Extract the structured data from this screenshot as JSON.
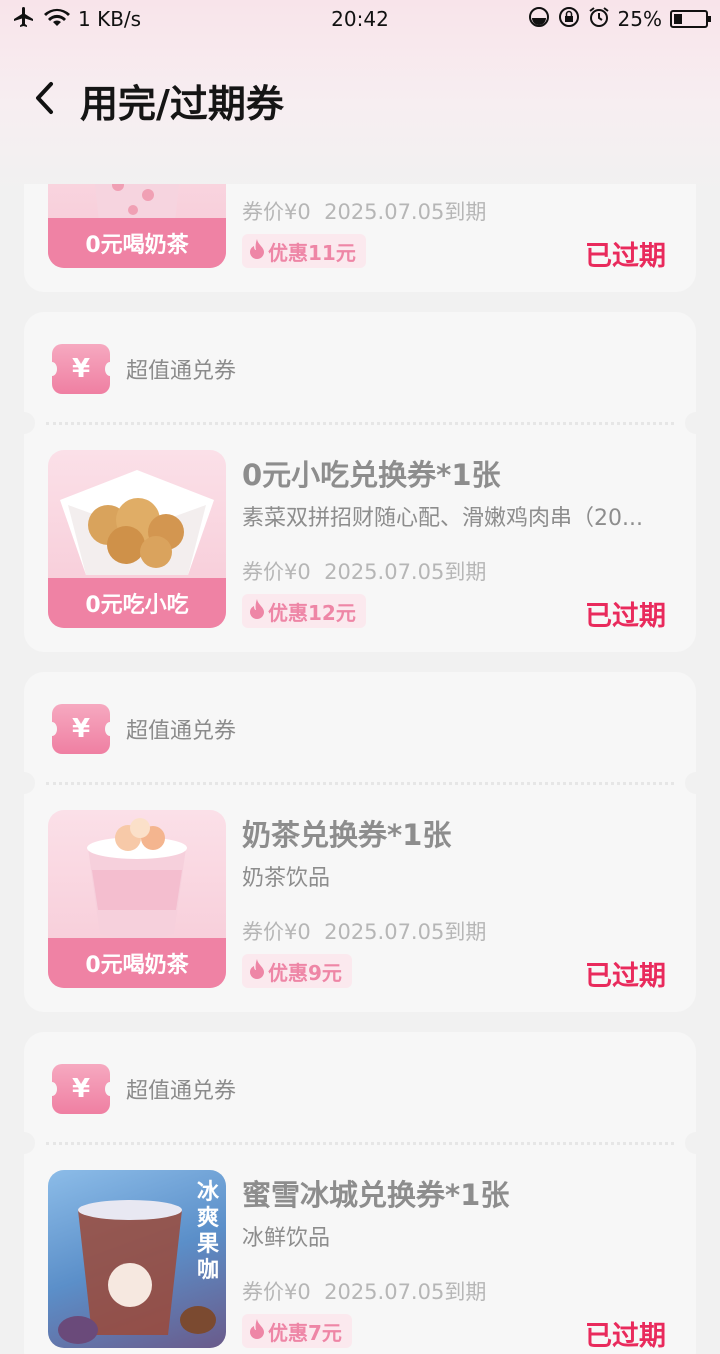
{
  "status_bar": {
    "net_speed": "1 KB/s",
    "time": "20:42",
    "battery_pct": "25%",
    "battery_level": 0.25,
    "icons": [
      "airplane-icon",
      "wifi-icon",
      "data-saver-icon",
      "rotation-lock-icon",
      "alarm-icon",
      "battery-icon"
    ]
  },
  "header": {
    "title": "用完/过期券",
    "back_icon": "chevron-left-icon"
  },
  "colors": {
    "accent": "#ef82a4",
    "status_expired": "#e92a5c",
    "discount_bg": "#fbe9ee"
  },
  "coupons": [
    {
      "type": "超值通兑券",
      "title": "",
      "desc": "",
      "image_label": "0元喝奶茶",
      "image": "milk-tea",
      "price_text": "券价¥0",
      "expire_text": "2025.07.05到期",
      "discount": "优惠11元",
      "status": "已过期"
    },
    {
      "type": "超值通兑券",
      "title": "0元小吃兑换券*1张",
      "desc": "素菜双拼招财随心配、滑嫩鸡肉串（20...",
      "image_label": "0元吃小吃",
      "image": "snack",
      "price_text": "券价¥0",
      "expire_text": "2025.07.05到期",
      "discount": "优惠12元",
      "status": "已过期"
    },
    {
      "type": "超值通兑券",
      "title": "奶茶兑换券*1张",
      "desc": "奶茶饮品",
      "image_label": "0元喝奶茶",
      "image": "milk-tea",
      "price_text": "券价¥0",
      "expire_text": "2025.07.05到期",
      "discount": "优惠9元",
      "status": "已过期"
    },
    {
      "type": "超值通兑券",
      "title": "蜜雪冰城兑换券*1张",
      "desc": "冰鲜饮品",
      "image_label": "",
      "image_text": "冰爽果咖",
      "image": "iced-coffee",
      "price_text": "券价¥0",
      "expire_text": "2025.07.05到期",
      "discount": "优惠7元",
      "status": "已过期"
    }
  ]
}
